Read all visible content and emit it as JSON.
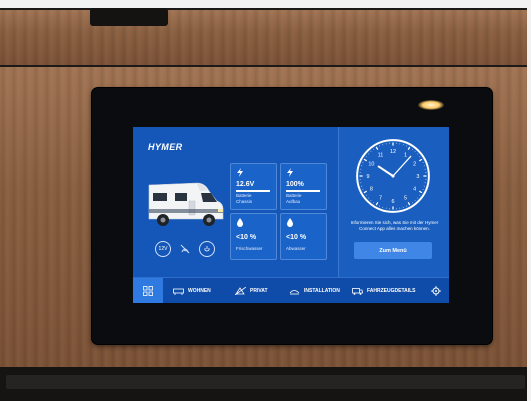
{
  "brand": {
    "logo": "HYMER"
  },
  "vehicle": {
    "status_icons": [
      {
        "label": "12V",
        "icon": "battery-12v-icon"
      },
      {
        "label": "",
        "icon": "signal-off-icon"
      },
      {
        "label": "",
        "icon": "power-plug-icon"
      }
    ]
  },
  "tiles": [
    {
      "icon": "lightning-icon",
      "value": "12.6V",
      "label_line1": "Batterie",
      "label_line2": "Chassis",
      "show_bar": true
    },
    {
      "icon": "lightning-icon",
      "value": "100%",
      "label_line1": "Batterie",
      "label_line2": "Aufbau",
      "show_bar": true
    },
    {
      "icon": "water-drop-icon",
      "value": "<10 %",
      "label_line1": "Frischwasser",
      "label_line2": "",
      "show_bar": false
    },
    {
      "icon": "water-drop-icon",
      "value": "<10 %",
      "label_line1": "Abwasser",
      "label_line2": "",
      "show_bar": false
    }
  ],
  "clock": {
    "hour": 10,
    "minute": 7
  },
  "connect": {
    "info": "Informieren Sie sich, was Sie mit der Hymer Connect App alles machen können.",
    "button": "Zum Menü"
  },
  "nav": {
    "items": [
      {
        "label": "WOHNEN",
        "icon": "living-icon"
      },
      {
        "label": "PRIVAT",
        "icon": "privacy-icon"
      },
      {
        "label": "INSTALLATION",
        "icon": "installation-icon"
      },
      {
        "label": "FAHRZEUGDETAILS",
        "icon": "vehicle-details-icon"
      }
    ]
  },
  "colors": {
    "screen_bg": "#1557b8",
    "accent": "#3f86e6",
    "nav_bg": "#0f4ba8"
  }
}
